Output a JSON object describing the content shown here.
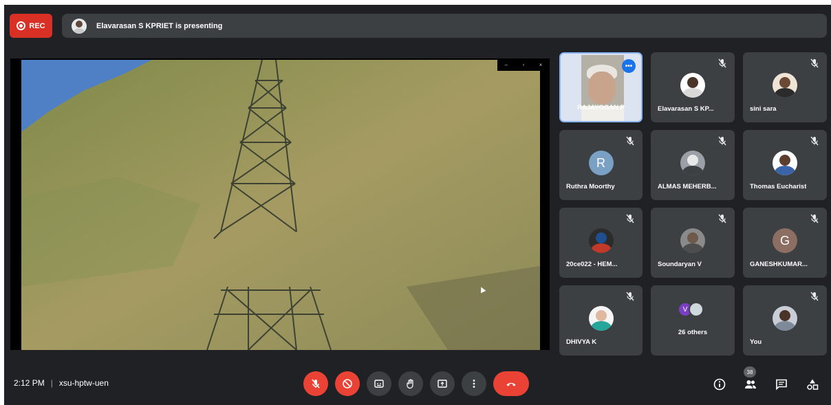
{
  "recording": {
    "label": "REC"
  },
  "presenting": {
    "text": "Elavarasan S KPRIET is presenting"
  },
  "screen_window": {
    "controls": [
      "–",
      "▫",
      "×"
    ]
  },
  "tiles": [
    {
      "name": "RAJAYOGAN P",
      "type": "video",
      "active": true
    },
    {
      "name": "Elavarasan S KP...",
      "type": "photo",
      "face": "#4a3428",
      "body": "#d9d9d9",
      "bg": "#ffffff"
    },
    {
      "name": "sini sara",
      "type": "photo",
      "face": "#6b4a35",
      "body": "#2b2b2b",
      "bg": "#f0e4d6"
    },
    {
      "name": "Ruthra Moorthy",
      "type": "letter",
      "letter": "R",
      "color": "#7aa0c4"
    },
    {
      "name": "ALMAS MEHERB...",
      "type": "photo",
      "face": "#e8e8e8",
      "body": "#3c4043",
      "bg": "#9aa0a6"
    },
    {
      "name": "Thomas Eucharist",
      "type": "photo",
      "face": "#5c3d2e",
      "body": "#3a63a8",
      "bg": "#ffffff"
    },
    {
      "name": "20ce022 - HEM...",
      "type": "photo",
      "face": "#1f4f8f",
      "body": "#c0392b",
      "bg": "#2c2c2c"
    },
    {
      "name": "Soundaryan V",
      "type": "photo",
      "face": "#6d5a4a",
      "body": "#4d4d4d",
      "bg": "#8a8a8a"
    },
    {
      "name": "GANESHKUMAR...",
      "type": "letter",
      "letter": "G",
      "color": "#8d6e63"
    },
    {
      "name": "DHIVYA K",
      "type": "photo",
      "face": "#e0b8a0",
      "body": "#26a69a",
      "bg": "#f5f5f5"
    },
    {
      "name": "26 others",
      "type": "others",
      "letter": "V"
    },
    {
      "name": "You",
      "type": "photo",
      "face": "#4a3428",
      "body": "#7e8a9a",
      "bg": "#c9ced6"
    }
  ],
  "footer": {
    "time": "2:12 PM",
    "separator": "|",
    "meeting_code": "xsu-hptw-uen",
    "participants_count": "38"
  },
  "colors": {
    "background": "#202124",
    "tile": "#3c4043",
    "danger": "#ea4335",
    "accent": "#8ab4f8"
  }
}
